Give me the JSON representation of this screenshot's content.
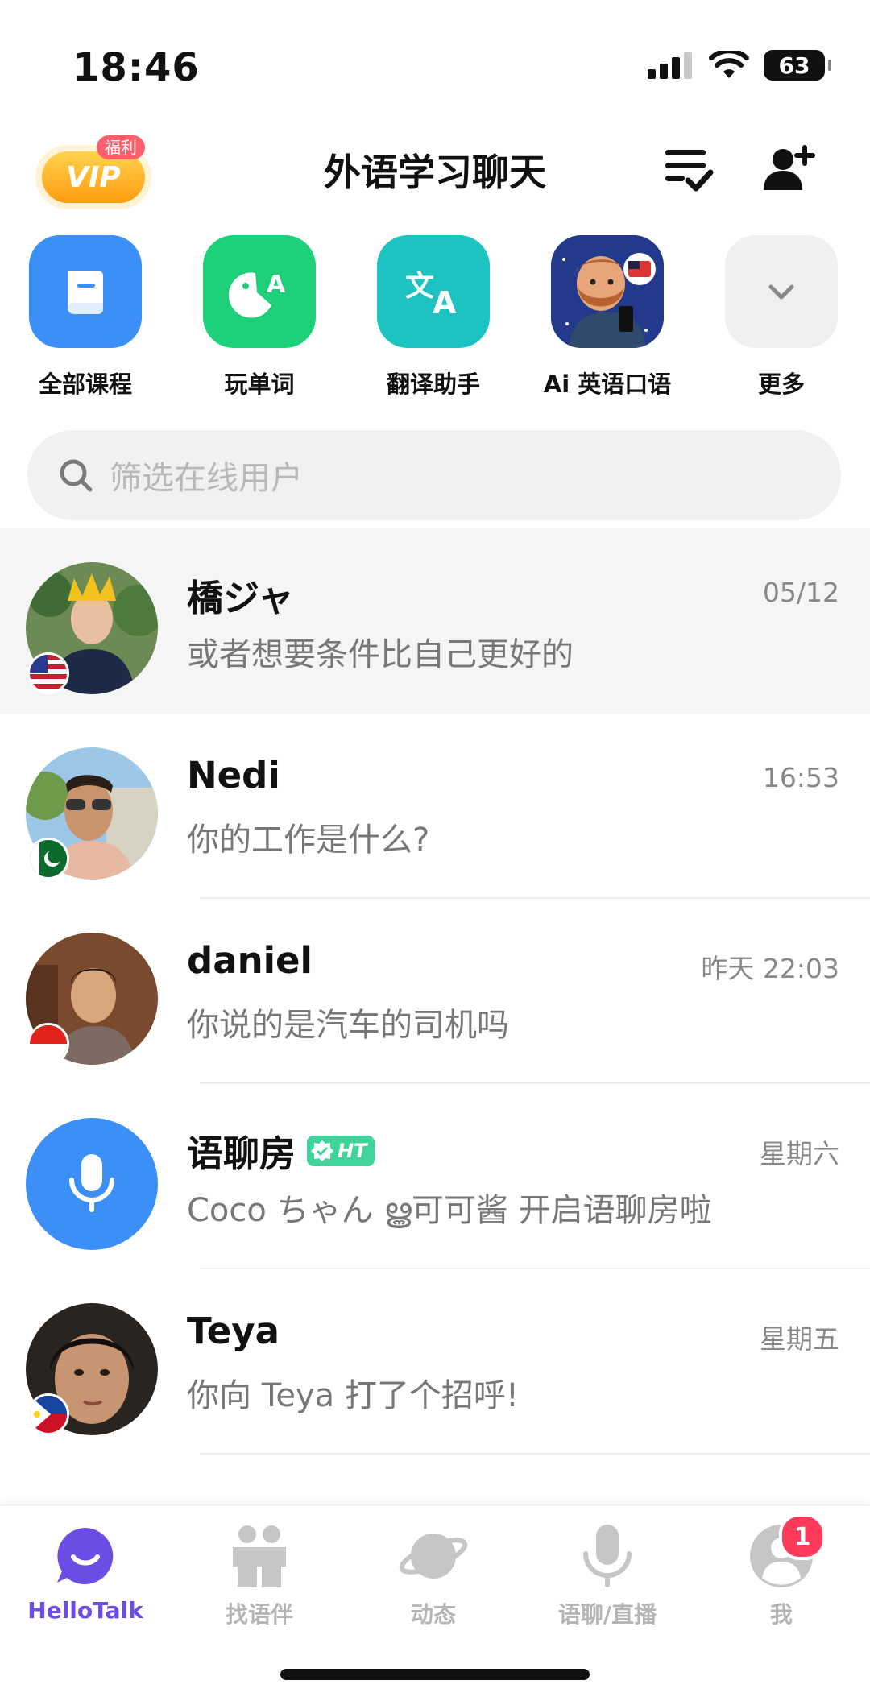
{
  "status_bar": {
    "time": "18:46",
    "battery": "63"
  },
  "header": {
    "title": "外语学习聊天",
    "vip_label": "VIP",
    "vip_badge": "福利"
  },
  "quick_actions": [
    {
      "label": "全部课程",
      "icon": "book-icon",
      "color": "#3b8ff6"
    },
    {
      "label": "玩单词",
      "icon": "word-game-icon",
      "color": "#1fd07a"
    },
    {
      "label": "翻译助手",
      "icon": "translate-icon",
      "color": "#1cc3c0"
    },
    {
      "label": "Ai 英语口语",
      "icon": "ai-tutor-avatar",
      "color": "#233a8c"
    },
    {
      "label": "更多",
      "icon": "chevron-down-icon",
      "color": "#f0f0f0"
    }
  ],
  "search": {
    "placeholder": "筛选在线用户"
  },
  "chats": [
    {
      "name": "橋ジャ",
      "message": "或者想要条件比自己更好的",
      "time": "05/12",
      "flag": "us-flag-icon"
    },
    {
      "name": "Nedi",
      "message": "你的工作是什么?",
      "time": "16:53",
      "flag": "pakistan-flag-icon"
    },
    {
      "name": "daniel",
      "message": "你说的是汽车的司机吗",
      "time": "昨天 22:03",
      "flag": "indonesia-flag-icon"
    },
    {
      "name": "语聊房",
      "badge": "HT",
      "message": "Coco ちゃん ൠ可可酱  开启语聊房啦",
      "time": "星期六"
    },
    {
      "name": "Teya",
      "message": "你向 Teya 打了个招呼!",
      "time": "星期五",
      "flag": "philippines-flag-icon"
    }
  ],
  "tabs": [
    {
      "label": "HelloTalk",
      "active": true
    },
    {
      "label": "找语伴"
    },
    {
      "label": "动态"
    },
    {
      "label": "语聊/直播"
    },
    {
      "label": "我",
      "badge": "1"
    }
  ],
  "colors": {
    "accent": "#6b4de6",
    "blue": "#3b8ff6",
    "badge_red": "#ff3b5c",
    "ht_green": "#3fd59a"
  }
}
